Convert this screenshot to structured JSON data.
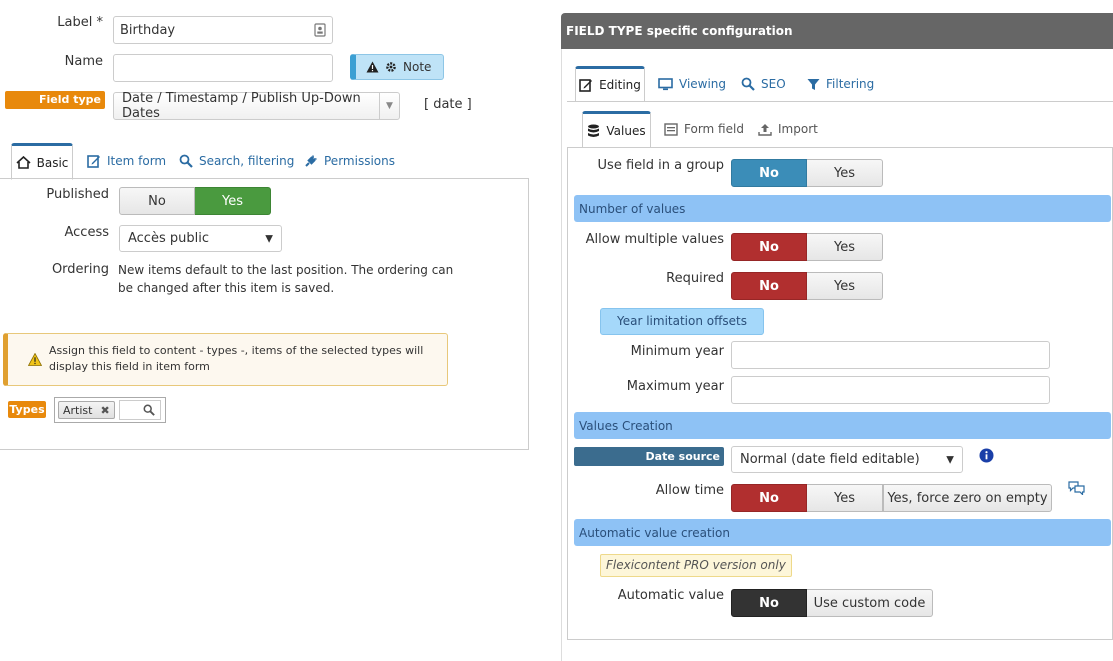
{
  "left": {
    "label_label": "Label *",
    "label_value": "Birthday",
    "name_label": "Name",
    "name_value": "",
    "note_label": "Note",
    "field_type_badge": "Field type",
    "field_type_value": "Date / Timestamp / Publish Up-Down Dates",
    "field_type_code": "[ date ]",
    "tabs": [
      {
        "label": "Basic",
        "icon": "home-icon"
      },
      {
        "label": "Item form",
        "icon": "edit-icon"
      },
      {
        "label": "Search, filtering",
        "icon": "search-icon"
      },
      {
        "label": "Permissions",
        "icon": "plug-icon"
      }
    ],
    "published_label": "Published",
    "published_options": [
      "No",
      "Yes"
    ],
    "access_label": "Access",
    "access_value": "Accès public",
    "ordering_label": "Ordering",
    "ordering_text": "New items default to the last position. The ordering can be changed after this item is saved.",
    "warning_text": "Assign this field to content - types -, items of the selected types will display this field in item form",
    "types_badge": "Types",
    "types_tag": "Artist"
  },
  "right": {
    "header": "FIELD TYPE specific configuration",
    "main_tabs": [
      {
        "label": "Editing",
        "icon": "edit-icon"
      },
      {
        "label": "Viewing",
        "icon": "monitor-icon"
      },
      {
        "label": "SEO",
        "icon": "search-icon"
      },
      {
        "label": "Filtering",
        "icon": "filter-icon"
      }
    ],
    "sub_tabs": [
      {
        "label": "Values",
        "icon": "database-icon"
      },
      {
        "label": "Form field",
        "icon": "form-icon"
      },
      {
        "label": "Import",
        "icon": "upload-icon"
      }
    ],
    "use_group_label": "Use field in a group",
    "use_group_options": [
      "No",
      "Yes"
    ],
    "section_number_of_values": "Number of values",
    "allow_multiple_label": "Allow multiple values",
    "allow_multiple_options": [
      "No",
      "Yes"
    ],
    "required_label": "Required",
    "required_options": [
      "No",
      "Yes"
    ],
    "year_limitation_label": "Year limitation offsets",
    "min_year_label": "Minimum year",
    "min_year_value": "",
    "max_year_label": "Maximum year",
    "max_year_value": "",
    "section_values_creation": "Values Creation",
    "date_source_badge": "Date source",
    "date_source_value": "Normal (date field editable)",
    "allow_time_label": "Allow time",
    "allow_time_options": [
      "No",
      "Yes",
      "Yes, force zero on empty"
    ],
    "section_automatic": "Automatic value creation",
    "pro_note": "Flexicontent PRO version only",
    "automatic_label": "Automatic value",
    "automatic_options": [
      "No",
      "Use custom code"
    ]
  },
  "colors": {
    "accent_blue": "#2b6ca3",
    "orange_badge": "#e8890c",
    "toggle_green": "#4a9a3f",
    "toggle_red": "#b12f2f",
    "toggle_blue": "#3b8db8",
    "section_blue": "#8ec2f5",
    "header_gray": "#666666"
  }
}
